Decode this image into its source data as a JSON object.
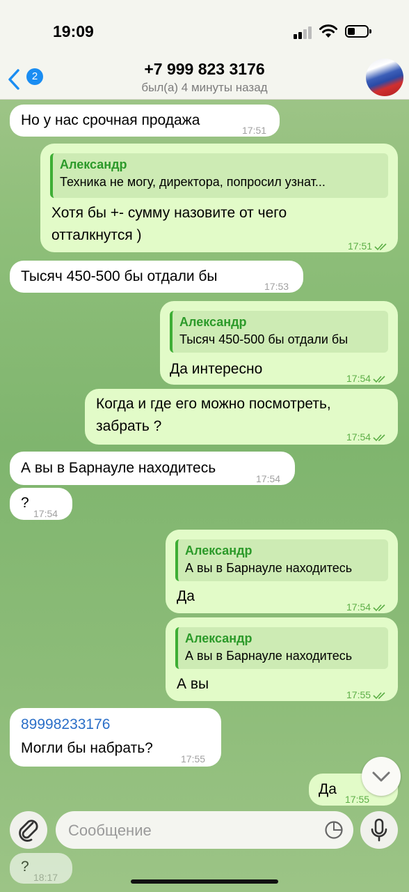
{
  "status": {
    "time": "19:09"
  },
  "header": {
    "back_badge": "2",
    "title": "+7 999 823 3176",
    "subtitle": "был(а) 4 минуты назад"
  },
  "messages": [
    {
      "dir": "in",
      "text": "Но у нас срочная продажа",
      "time": "17:51"
    },
    {
      "dir": "out",
      "reply_name": "Александр",
      "reply_text": "Техника не могу, директора, попросил узнат...",
      "text_line1": "Хотя бы +- сумму назовите от чего",
      "text_line2": "отталкнутся )",
      "time": "17:51"
    },
    {
      "dir": "in",
      "text": "Тысяч 450-500 бы отдали бы",
      "time": "17:53"
    },
    {
      "dir": "out",
      "reply_name": "Александр",
      "reply_text": "Тысяч 450-500 бы отдали бы",
      "text": "Да интересно",
      "time": "17:54"
    },
    {
      "dir": "out",
      "text_line1": "Когда и где его можно посмотреть,",
      "text_line2": "забрать ?",
      "time": "17:54"
    },
    {
      "dir": "in",
      "text": "А вы в Барнауле находитесь",
      "time": "17:54"
    },
    {
      "dir": "in",
      "text": "?",
      "time": "17:54"
    },
    {
      "dir": "out",
      "reply_name": "Александр",
      "reply_text": "А вы в Барнауле находитесь",
      "text": "Да",
      "time": "17:54"
    },
    {
      "dir": "out",
      "reply_name": "Александр",
      "reply_text": "А вы в Барнауле находитесь",
      "text": "А вы",
      "time": "17:55"
    },
    {
      "dir": "in",
      "link": "89998233176",
      "text": "Могли бы набрать?",
      "time": "17:55"
    },
    {
      "dir": "out",
      "text": "Да",
      "time": "17:55"
    },
    {
      "dir": "in",
      "text": "?",
      "time": "18:17"
    }
  ],
  "composer": {
    "placeholder": "Сообщение"
  },
  "icons": {
    "back": "chevron-left-icon",
    "attach": "paperclip-icon",
    "sticker": "sticker-icon",
    "mic": "microphone-icon",
    "scroll": "chevron-down-icon"
  },
  "colors": {
    "accent": "#1a8df2",
    "outgoing_bubble": "#e2fbc8",
    "incoming_bubble": "#ffffff",
    "reply_name": "#2c9a2a"
  }
}
